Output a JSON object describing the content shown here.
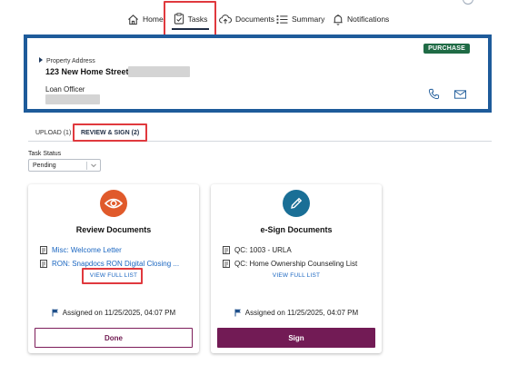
{
  "nav": {
    "items": [
      {
        "label": "Home",
        "icon": "home-icon"
      },
      {
        "label": "Tasks",
        "icon": "clipboard-check-icon"
      },
      {
        "label": "Documents",
        "icon": "cloud-upload-icon"
      },
      {
        "label": "Summary",
        "icon": "list-icon"
      },
      {
        "label": "Notifications",
        "icon": "bell-icon"
      }
    ],
    "active": "Tasks"
  },
  "loan": {
    "badge": "PURCHASE",
    "property_label": "Property Address",
    "property_address": "123 New Home Street,",
    "loan_officer_label": "Loan Officer",
    "icons": [
      "phone-icon",
      "mail-icon"
    ]
  },
  "subtabs": {
    "upload": "UPLOAD (1)",
    "review": "REVIEW & SIGN (2)",
    "active": "review"
  },
  "status": {
    "label": "Task Status",
    "value": "Pending"
  },
  "cards": [
    {
      "title": "Review Documents",
      "icon": "eye-icon",
      "icon_color": "#e05a2b",
      "docs": [
        "Misc: Welcome Letter",
        "RON: Snapdocs RON Digital Closing ..."
      ],
      "view_full": "VIEW FULL LIST",
      "assigned": "Assigned on 11/25/2025, 04:07 PM",
      "button": "Done"
    },
    {
      "title": "e-Sign Documents",
      "icon": "pen-icon",
      "icon_color": "#1a6f96",
      "docs": [
        "QC: 1003 - URLA",
        "QC: Home Ownership Counseling List"
      ],
      "view_full": "VIEW FULL LIST",
      "assigned": "Assigned on 11/25/2025, 04:07 PM",
      "button": "Sign"
    }
  ],
  "colors": {
    "accent_blue": "#1e5b9a",
    "highlight_red": "#e0393e",
    "badge_green": "#1f6b45",
    "button_purple": "#721b55",
    "link_blue": "#1a66c1"
  }
}
